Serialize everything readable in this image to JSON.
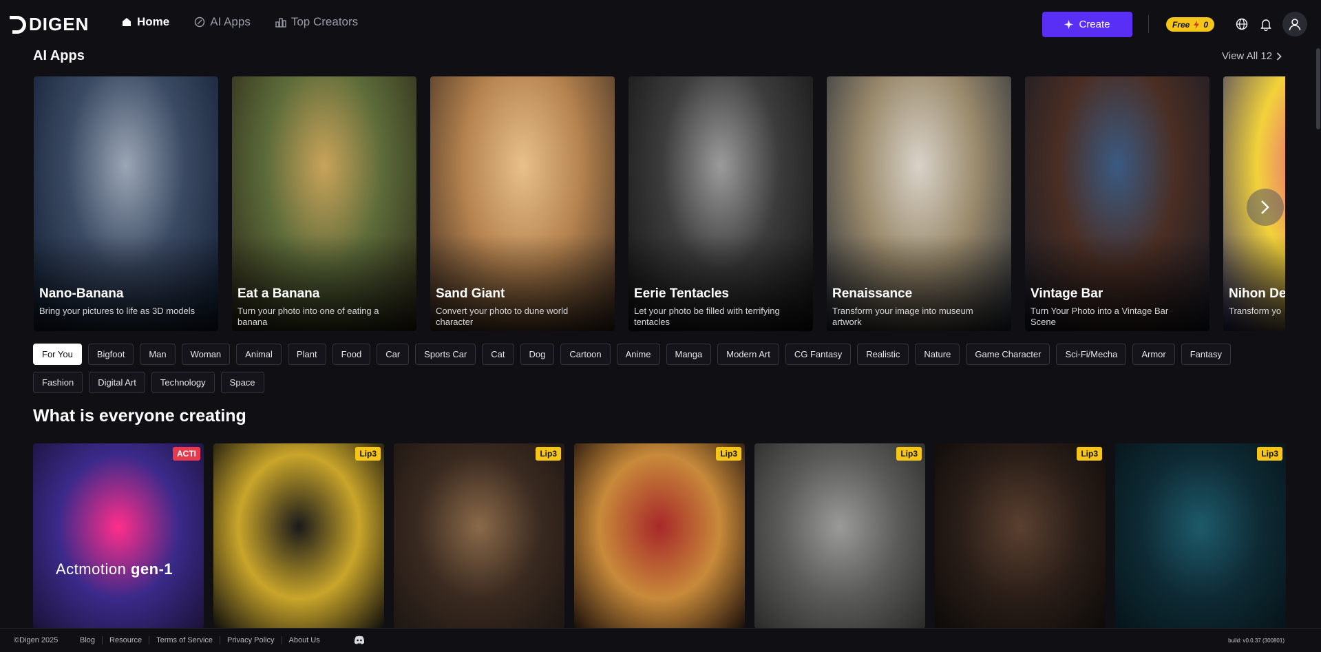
{
  "header": {
    "logo_text": "DIGEN",
    "nav": [
      {
        "label": "Home",
        "icon": "home-icon",
        "active": true
      },
      {
        "label": "AI Apps",
        "icon": "apps-icon",
        "active": false
      },
      {
        "label": "Top Creators",
        "icon": "ranking-icon",
        "active": false
      }
    ],
    "create_label": "Create",
    "credits": {
      "plan": "Free",
      "count": "0"
    },
    "icons": [
      "globe-icon",
      "bell-icon",
      "user-icon"
    ]
  },
  "ai_apps": {
    "title": "AI Apps",
    "view_all": "View All 12",
    "apps": [
      {
        "name": "Nano-Banana",
        "desc": "Bring your pictures to life as 3D models",
        "colors": [
          "#9aa6b5",
          "#3b4a63",
          "#0e1a2e"
        ]
      },
      {
        "name": "Eat a Banana",
        "desc": "Turn your photo into one of eating a banana",
        "colors": [
          "#c9a35a",
          "#5c6b3a",
          "#2a2416"
        ]
      },
      {
        "name": "Sand Giant",
        "desc": "Convert your photo to dune world character",
        "colors": [
          "#e8c08a",
          "#b5834f",
          "#3a2a20"
        ]
      },
      {
        "name": "Eerie Tentacles",
        "desc": "Let your photo be filled with terrifying tentacles",
        "colors": [
          "#9b9b9b",
          "#3c3c3c",
          "#101010"
        ]
      },
      {
        "name": "Renaissance",
        "desc": "Transform your image into museum artwork",
        "colors": [
          "#d8d2c8",
          "#9a8a6c",
          "#232a36"
        ]
      },
      {
        "name": "Vintage Bar",
        "desc": "Turn Your Photo into a Vintage Bar Scene",
        "colors": [
          "#3a5a82",
          "#4a2e24",
          "#151a26"
        ]
      },
      {
        "name": "Nihon Dev",
        "desc": "Transform yo",
        "colors": [
          "#e84a8a",
          "#f2d23a",
          "#2a2a6a"
        ]
      }
    ]
  },
  "tags": [
    "For You",
    "Bigfoot",
    "Man",
    "Woman",
    "Animal",
    "Plant",
    "Food",
    "Car",
    "Sports Car",
    "Cat",
    "Dog",
    "Cartoon",
    "Anime",
    "Manga",
    "Modern Art",
    "CG Fantasy",
    "Realistic",
    "Nature",
    "Game Character",
    "Sci-Fi/Mecha",
    "Armor",
    "Fantasy",
    "Fashion",
    "Digital Art",
    "Technology",
    "Space"
  ],
  "feed": {
    "title": "What is everyone creating",
    "items": [
      {
        "badge": "ACTI",
        "badge_color": "#e83a4f",
        "overlay_a": "Actmotion",
        "overlay_b": "gen-1",
        "colors": [
          "#ff2f8a",
          "#3b2a8a",
          "#1a1238"
        ]
      },
      {
        "badge": "Lip3",
        "badge_color": "#f5c518",
        "colors": [
          "#1a1a1a",
          "#c9a52a",
          "#0c0c0c"
        ]
      },
      {
        "badge": "Lip3",
        "badge_color": "#f5c518",
        "colors": [
          "#8a6a4a",
          "#3a2a20",
          "#1c1612"
        ]
      },
      {
        "badge": "Lip3",
        "badge_color": "#f5c518",
        "colors": [
          "#a8282a",
          "#c88a3a",
          "#1a0e0a"
        ]
      },
      {
        "badge": "Lip3",
        "badge_color": "#f5c518",
        "colors": [
          "#9a9a98",
          "#5a5a58",
          "#2a2a28"
        ]
      },
      {
        "badge": "Lip3",
        "badge_color": "#f5c518",
        "colors": [
          "#5a4030",
          "#2a1e18",
          "#0c0a08"
        ]
      },
      {
        "badge": "Lip3",
        "badge_color": "#f5c518",
        "colors": [
          "#1e5a6a",
          "#0e2a34",
          "#061418"
        ]
      }
    ]
  },
  "footer": {
    "copyright": "©Digen 2025",
    "links": [
      "Blog",
      "Resource",
      "Terms of Service",
      "Privacy Policy",
      "About Us"
    ],
    "build": "build: v0.0.37 (300801)"
  }
}
